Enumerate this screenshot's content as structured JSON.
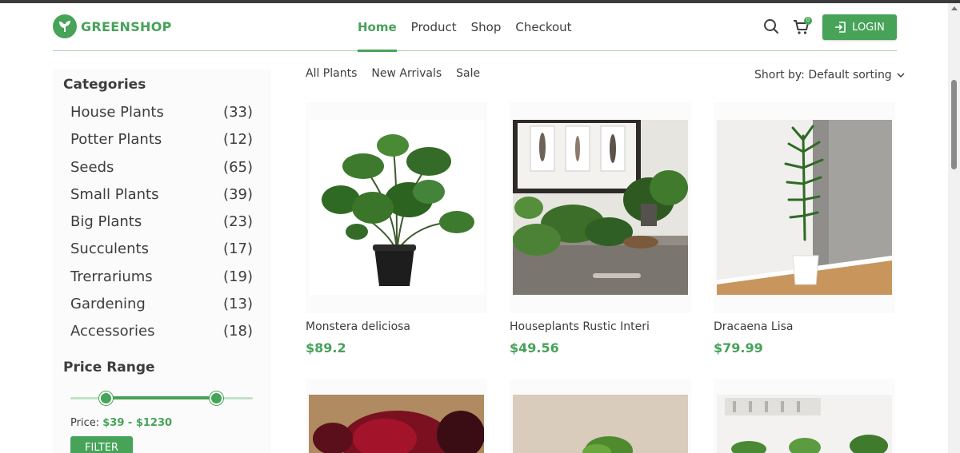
{
  "brand": {
    "name": "GREENSHOP",
    "logo_icon": "leaf-logo-icon",
    "accent": "#46a358"
  },
  "nav": {
    "items": [
      {
        "label": "Home",
        "active": true
      },
      {
        "label": "Product",
        "active": false
      },
      {
        "label": "Shop",
        "active": false
      },
      {
        "label": "Checkout",
        "active": false
      }
    ]
  },
  "header_actions": {
    "search_icon": "search-icon",
    "cart_icon": "cart-icon",
    "cart_count": "0",
    "login_label": "LOGIN",
    "login_icon": "login-icon"
  },
  "sidebar": {
    "categories_title": "Categories",
    "categories": [
      {
        "label": "House Plants",
        "count": "(33)"
      },
      {
        "label": "Potter Plants",
        "count": "(12)"
      },
      {
        "label": "Seeds",
        "count": "(65)"
      },
      {
        "label": "Small Plants",
        "count": "(39)"
      },
      {
        "label": "Big Plants",
        "count": "(23)"
      },
      {
        "label": "Succulents",
        "count": "(17)"
      },
      {
        "label": "Trerrariums",
        "count": "(19)"
      },
      {
        "label": "Gardening",
        "count": "(13)"
      },
      {
        "label": "Accessories",
        "count": "(18)"
      }
    ],
    "price_title": "Price Range",
    "price_prefix": "Price:",
    "price_value": "$39 - $1230",
    "range": {
      "min": 39,
      "max": 1230
    },
    "filter_label": "FILTER"
  },
  "main": {
    "tabs": [
      {
        "label": "All Plants"
      },
      {
        "label": "New Arrivals"
      },
      {
        "label": "Sale"
      }
    ],
    "sort_label": "Short by: Default sorting",
    "products": [
      {
        "name": "Monstera deliciosa",
        "price": "$89.2"
      },
      {
        "name": "Houseplants Rustic Interi",
        "price": "$49.56"
      },
      {
        "name": "Dracaena Lisa",
        "price": "$79.99"
      }
    ]
  }
}
